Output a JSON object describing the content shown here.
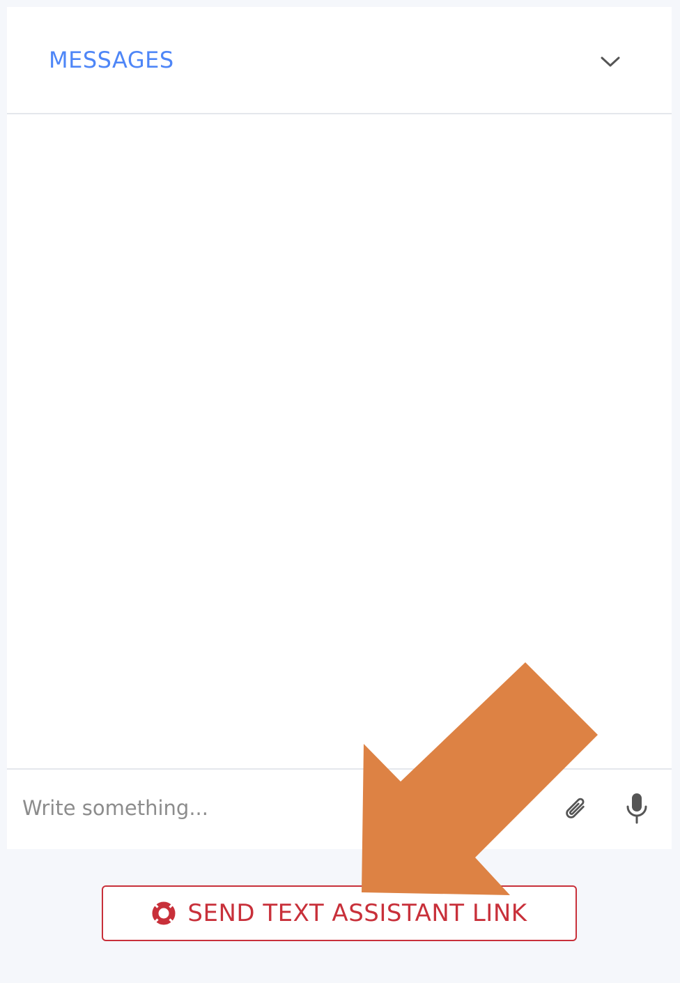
{
  "colors": {
    "accent": "#4e86f7",
    "danger": "#c8303a",
    "icon": "#555555",
    "annotation_arrow": "#dd8244"
  },
  "header": {
    "title": "MESSAGES",
    "collapse_icon": "chevron-down-icon"
  },
  "composer": {
    "placeholder": "Write something...",
    "value": "",
    "attach_icon": "paperclip-icon",
    "mic_icon": "microphone-icon"
  },
  "help_button": {
    "label": "SEND TEXT ASSISTANT LINK",
    "icon": "lifebuoy-icon"
  },
  "annotation": {
    "icon": "arrow-annotation-icon"
  }
}
